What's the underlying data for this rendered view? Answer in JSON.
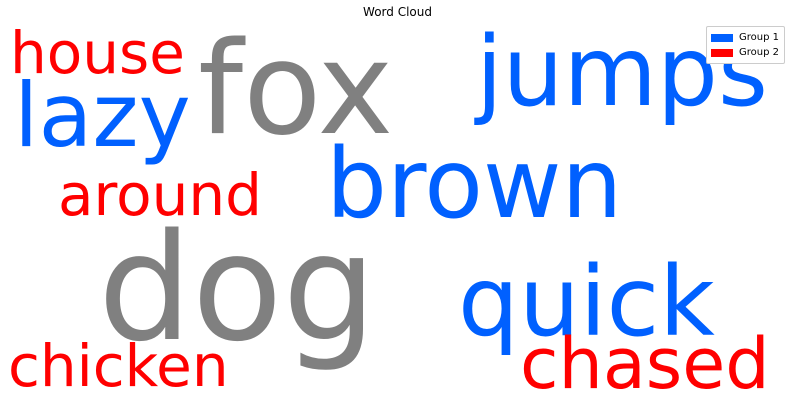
{
  "chart_data": {
    "type": "word-cloud",
    "title": "Word Cloud",
    "words": [
      {
        "text": "fox",
        "group": "gray",
        "weight": 1.0
      },
      {
        "text": "dog",
        "group": "gray",
        "weight": 1.0
      },
      {
        "text": "jumps",
        "group": "Group 1",
        "weight": 0.72
      },
      {
        "text": "brown",
        "group": "Group 1",
        "weight": 0.72
      },
      {
        "text": "quick",
        "group": "Group 1",
        "weight": 0.72
      },
      {
        "text": "lazy",
        "group": "Group 1",
        "weight": 0.72
      },
      {
        "text": "house",
        "group": "Group 2",
        "weight": 0.44
      },
      {
        "text": "around",
        "group": "Group 2",
        "weight": 0.44
      },
      {
        "text": "chicken",
        "group": "Group 2",
        "weight": 0.44
      },
      {
        "text": "chased",
        "group": "Group 2",
        "weight": 0.52
      }
    ],
    "legend": {
      "placement": "top-right",
      "entries": [
        {
          "label": "Group 1",
          "color": "#0060ff"
        },
        {
          "label": "Group 2",
          "color": "#ff0000"
        }
      ]
    },
    "colors": {
      "Group 1": "#0060ff",
      "Group 2": "#ff0000",
      "gray": "#808080"
    }
  }
}
